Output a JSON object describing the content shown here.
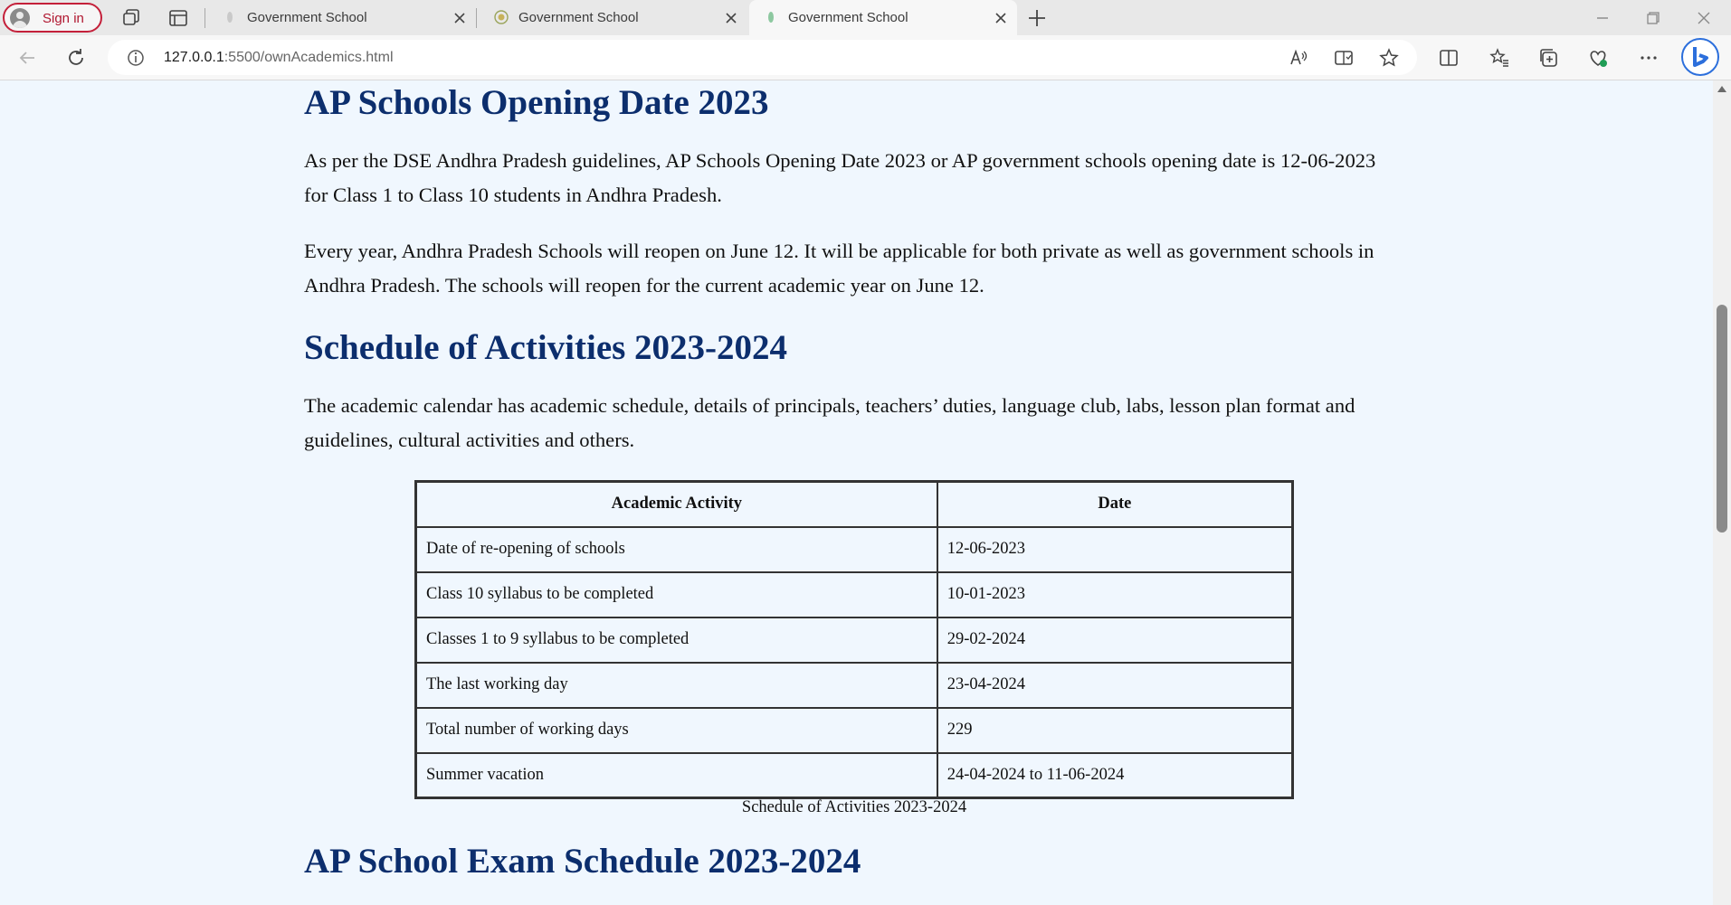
{
  "browser": {
    "signin_label": "Sign in",
    "tabs": [
      {
        "title": "Government School"
      },
      {
        "title": "Government School"
      },
      {
        "title": "Government School"
      }
    ],
    "url_host": "127.0.0.1",
    "url_path": ":5500/ownAcademics.html"
  },
  "page": {
    "section1": {
      "heading": "AP Schools Opening Date 2023",
      "para1": "As per the DSE Andhra Pradesh guidelines, AP Schools Opening Date 2023 or AP government schools opening date is 12-06-2023 for Class 1 to Class 10 students in Andhra Pradesh.",
      "para2": "Every year, Andhra Pradesh Schools will reopen on June 12. It will be applicable for both private as well as government schools in Andhra Pradesh. The schools will reopen for the current academic year on June 12."
    },
    "section2": {
      "heading": "Schedule of Activities 2023-2024",
      "para1": "The academic calendar has academic schedule, details of principals, teachers’ duties, language club, labs, lesson plan format and guidelines, cultural activities and others."
    },
    "table": {
      "headers": [
        "Academic Activity",
        "Date"
      ],
      "rows": [
        [
          "Date of re-opening of schools",
          "12-06-2023"
        ],
        [
          "Class 10 syllabus to be completed",
          "10-01-2023"
        ],
        [
          "Classes 1 to 9 syllabus to be completed",
          "29-02-2024"
        ],
        [
          "The last working day",
          "23-04-2024"
        ],
        [
          "Total number of working days",
          "229"
        ],
        [
          "Summer vacation",
          "24-04-2024 to 11-06-2024"
        ]
      ],
      "caption": "Schedule of Activities 2023-2024"
    },
    "section3": {
      "heading": "AP School Exam Schedule 2023-2024"
    }
  }
}
